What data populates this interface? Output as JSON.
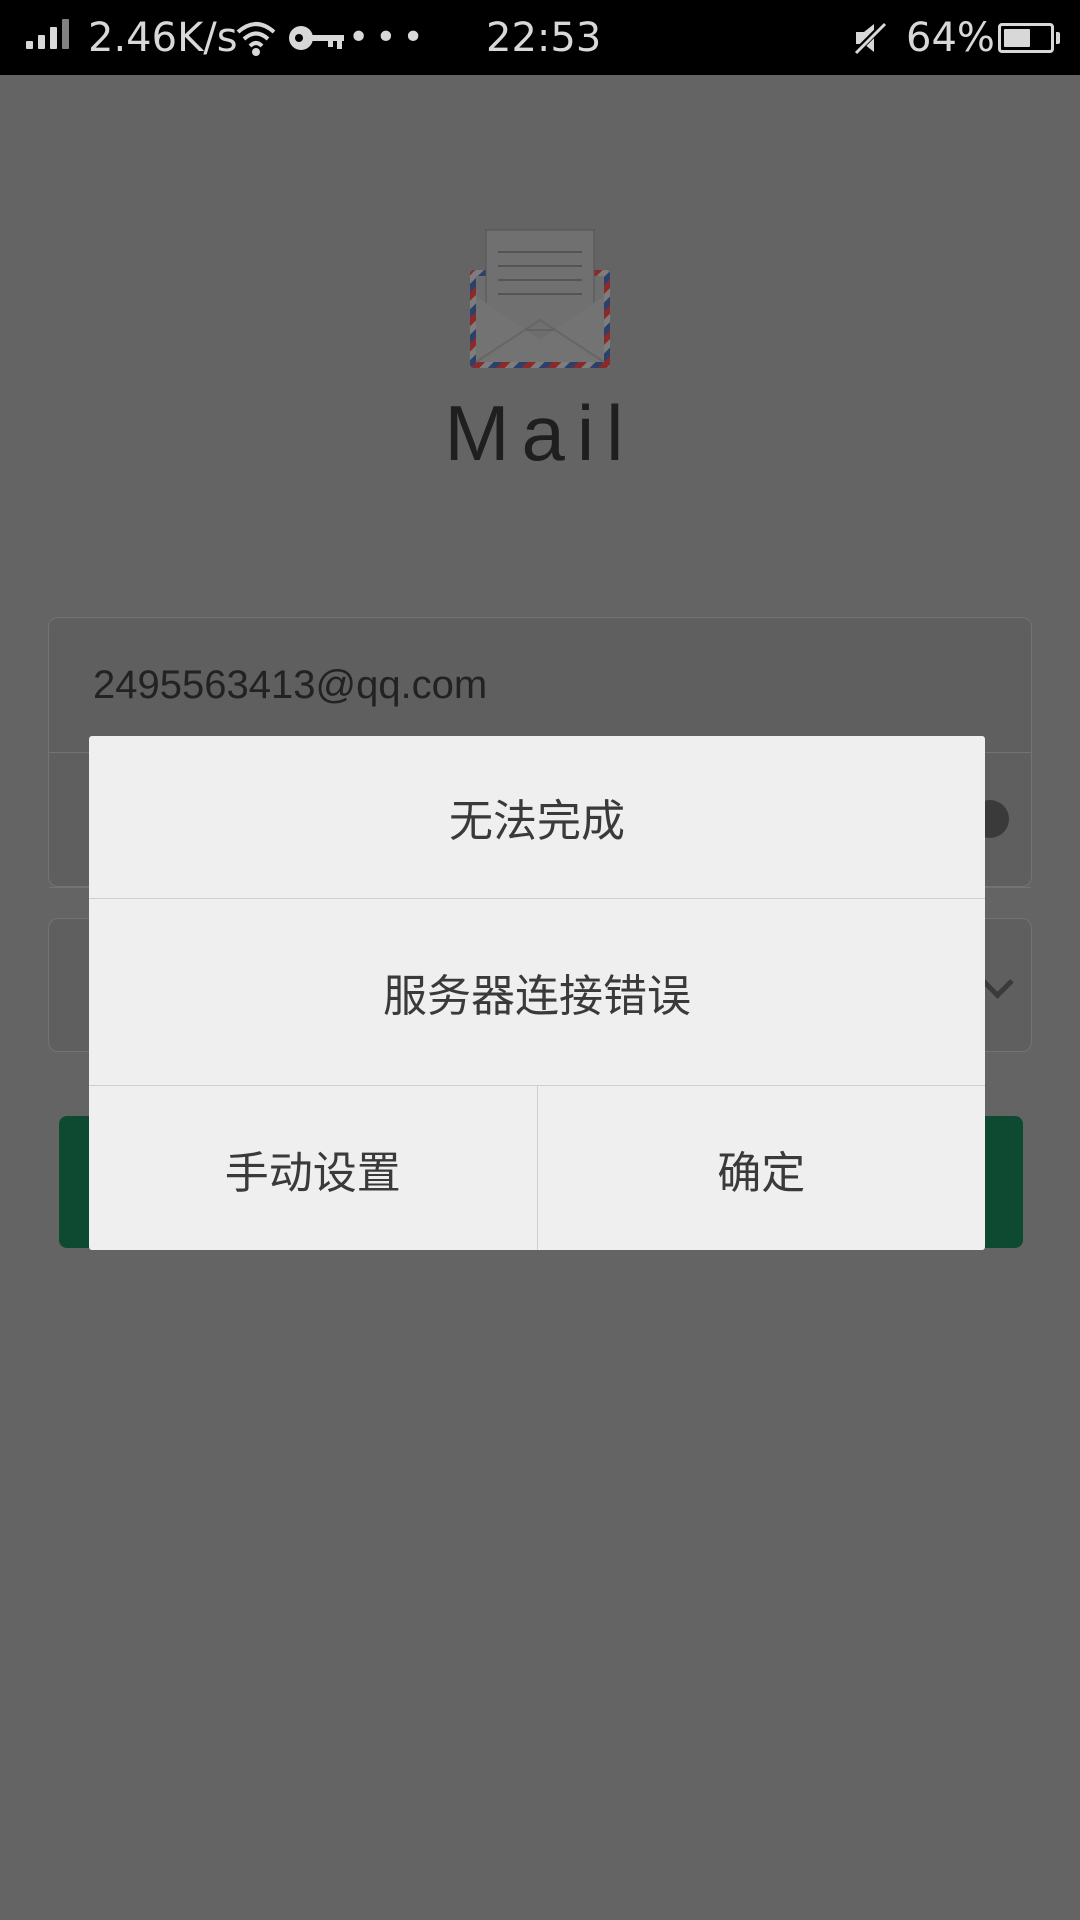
{
  "status_bar": {
    "net_speed": "2.46K/s",
    "time": "22:53",
    "battery_percent": "64%",
    "battery_level": 0.64,
    "dots": "•••",
    "icons": [
      "signal-icon",
      "wifi-icon",
      "key-icon",
      "mute-icon",
      "battery-icon"
    ]
  },
  "app": {
    "title": "Mail",
    "logo_icon": "envelope-icon"
  },
  "login_form": {
    "email_value": "2495563413@qq.com",
    "password_value": ""
  },
  "dialog": {
    "title": "无法完成",
    "message": "服务器连接错误",
    "buttons": {
      "manual": "手动设置",
      "ok": "确定"
    }
  },
  "colors": {
    "overlay_background": "#646464",
    "dialog_background": "#efefef",
    "login_button": "#0d4a31"
  }
}
